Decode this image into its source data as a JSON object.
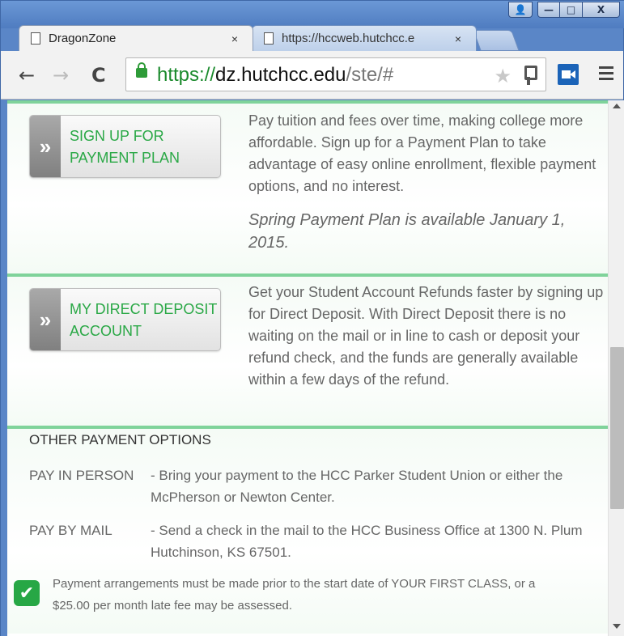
{
  "browser": {
    "tabs": [
      {
        "title": "DragonZone",
        "active": true
      },
      {
        "title": "https://hccweb.hutchcc.e",
        "active": false
      }
    ],
    "tab_close_glyph": "×",
    "nav": {
      "back_glyph": "←",
      "forward_glyph": "→",
      "reload_glyph": "C"
    },
    "address": {
      "scheme": "https://",
      "host": "dz.hutchcc.edu",
      "path": "/ste/#"
    },
    "star_glyph": "★",
    "window_controls": {
      "user_glyph": "👤",
      "minimize_glyph": "—",
      "maximize_glyph": "□",
      "close_glyph": "X"
    }
  },
  "payment_plan": {
    "chevron": "»",
    "button_label": "SIGN UP FOR PAYMENT PLAN",
    "description": "Pay tuition and fees over time, making college more affordable. Sign up for a Payment Plan to take advantage of easy online enrollment, flexible payment options, and no interest.",
    "note": "Spring Payment Plan is available January 1, 2015."
  },
  "direct_deposit": {
    "chevron": "»",
    "button_label": "MY DIRECT DEPOSIT ACCOUNT",
    "description": "Get your Student Account Refunds faster by signing up for Direct Deposit. With Direct Deposit there is no waiting on the mail or in line to cash or deposit your refund check, and the funds are generally available within a few days of the refund."
  },
  "other_options": {
    "title": "OTHER PAYMENT OPTIONS",
    "rows": [
      {
        "label": "PAY IN PERSON",
        "text": "- Bring your payment to the HCC Parker Student Union or either the McPherson or Newton Center."
      },
      {
        "label": "PAY BY MAIL",
        "text": "- Send a check in the mail to the HCC Business Office at 1300 N. Plum Hutchinson, KS 67501."
      }
    ],
    "check_glyph": "✔",
    "disclaimer": "Payment arrangements must be made prior to the start date of YOUR FIRST CLASS, or a $25.00 per month late fee may be assessed."
  },
  "colors": {
    "accent_green": "#2aa846",
    "divider_green": "#7fd39a",
    "chrome_blue": "#5a86c7"
  }
}
